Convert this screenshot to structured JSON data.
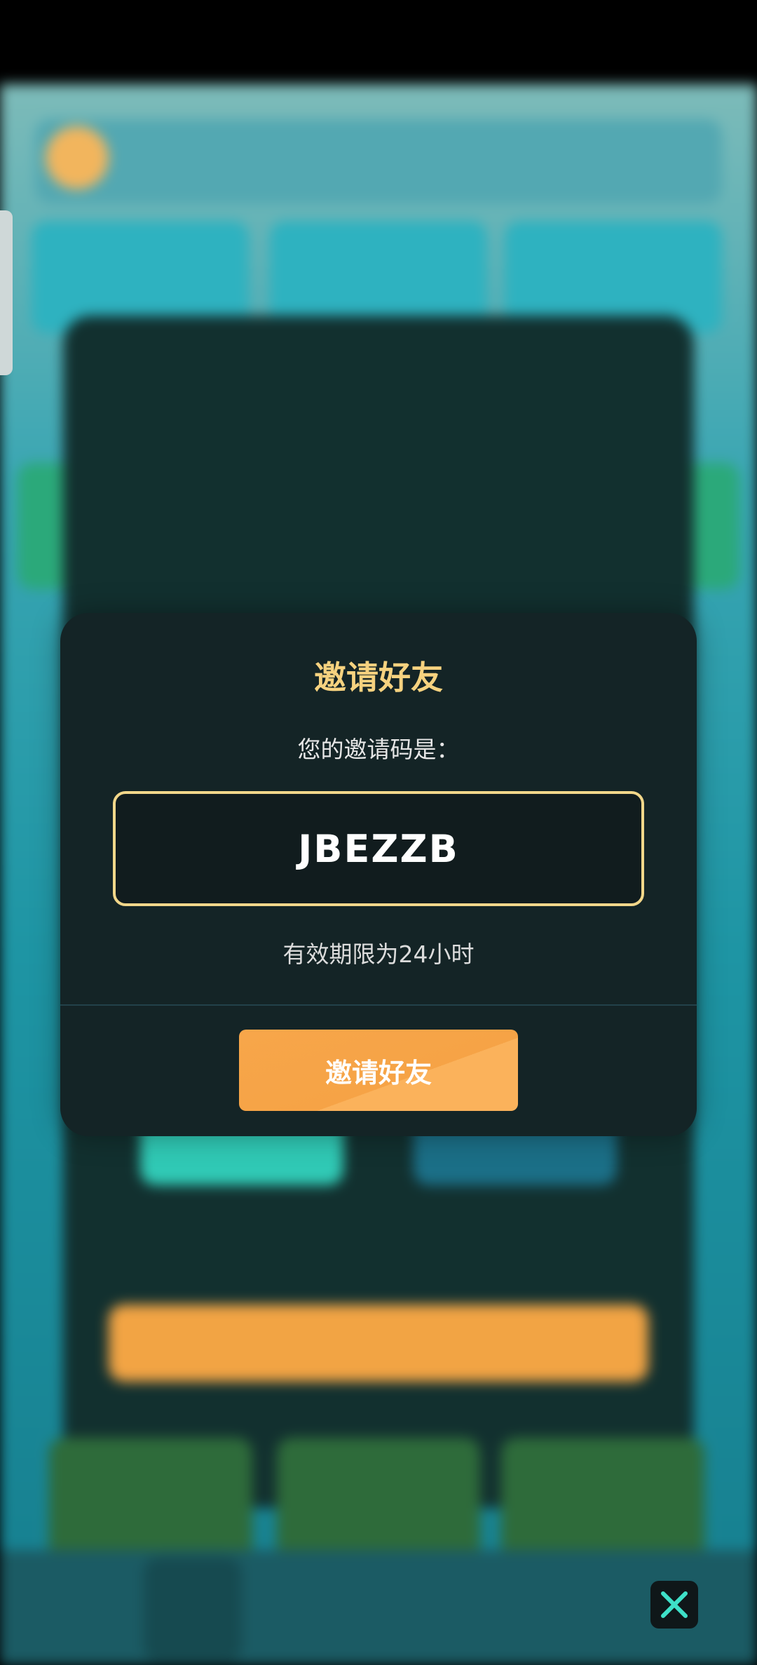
{
  "dialog": {
    "title": "邀请好友",
    "subtitle": "您的邀请码是：",
    "invite_code": "JBEZZB",
    "validity_text": "有效期限为24小时",
    "invite_button_label": "邀请好友"
  },
  "colors": {
    "title": "#f6d27f",
    "code_border": "#f2d78a",
    "button": "#f7a64a",
    "dialog_bg": "#142426",
    "close_icon": "#3ee0c8"
  },
  "icons": {
    "close": "close-icon"
  }
}
